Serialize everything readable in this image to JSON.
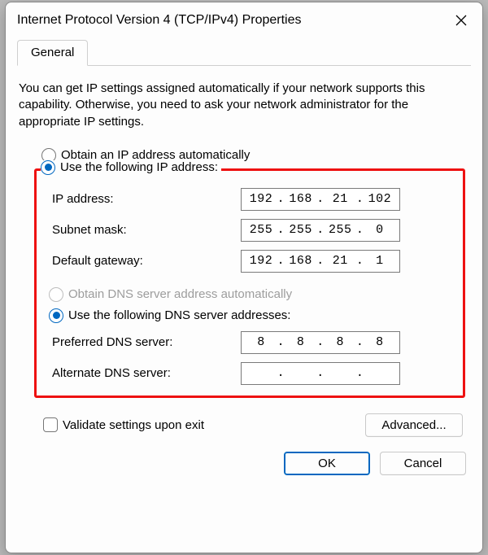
{
  "window": {
    "title": "Internet Protocol Version 4 (TCP/IPv4) Properties"
  },
  "tabs": {
    "general": "General"
  },
  "description": "You can get IP settings assigned automatically if your network supports this capability. Otherwise, you need to ask your network administrator for the appropriate IP settings.",
  "ip": {
    "auto_label": "Obtain an IP address automatically",
    "manual_label": "Use the following IP address:",
    "address_label": "IP address:",
    "subnet_label": "Subnet mask:",
    "gateway_label": "Default gateway:",
    "address": {
      "o1": "192",
      "o2": "168",
      "o3": "21",
      "o4": "102"
    },
    "subnet": {
      "o1": "255",
      "o2": "255",
      "o3": "255",
      "o4": "0"
    },
    "gateway": {
      "o1": "192",
      "o2": "168",
      "o3": "21",
      "o4": "1"
    }
  },
  "dns": {
    "auto_label": "Obtain DNS server address automatically",
    "manual_label": "Use the following DNS server addresses:",
    "preferred_label": "Preferred DNS server:",
    "alternate_label": "Alternate DNS server:",
    "preferred": {
      "o1": "8",
      "o2": "8",
      "o3": "8",
      "o4": "8"
    },
    "alternate": {
      "o1": "",
      "o2": "",
      "o3": "",
      "o4": ""
    }
  },
  "validate_label": "Validate settings upon exit",
  "buttons": {
    "advanced": "Advanced...",
    "ok": "OK",
    "cancel": "Cancel"
  }
}
